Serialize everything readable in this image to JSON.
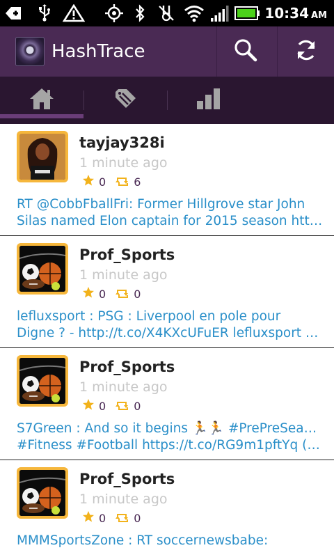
{
  "status_bar": {
    "time": "10:34",
    "ampm": "AM",
    "icons": [
      "usb-debug-icon",
      "usb-icon",
      "warning-icon",
      "gps-icon",
      "bluetooth-icon",
      "vibrate-icon",
      "wifi-icon",
      "signal-icon",
      "battery-icon"
    ]
  },
  "app_bar": {
    "title": "HashTrace",
    "search_icon": "search-icon",
    "refresh_icon": "refresh-icon"
  },
  "tabs": [
    {
      "name": "home",
      "icon": "home-icon",
      "selected": true
    },
    {
      "name": "compose",
      "icon": "pencil-tag-icon",
      "selected": false
    },
    {
      "name": "stats",
      "icon": "bar-chart-icon",
      "selected": false
    }
  ],
  "colors": {
    "app_bar": "#4a2a54",
    "tab_bar": "#2a1630",
    "link_text": "#2a8fc9",
    "star": "#f2b21b",
    "retweet": "#f2b21b",
    "avatar_frame": "#f6b73c"
  },
  "tweets": [
    {
      "username": "tayjay328i",
      "time": "1 minute ago",
      "favorites": "0",
      "retweets": "6",
      "text_line1": "RT @CobbFballFri: Former Hillgrove star John",
      "text_line2": "Silas named Elon captain for 2015 season htt…"
    },
    {
      "username": "Prof_Sports",
      "time": "1 minute ago",
      "favorites": "0",
      "retweets": "0",
      "text_line1": "lefluxsport : PSG : Liverpool en pole pour",
      "text_line2": "Digne ? - http://t.co/X4KXcUFuER lefluxsport …"
    },
    {
      "username": "Prof_Sports",
      "time": "1 minute ago",
      "favorites": "0",
      "retweets": "0",
      "text_line1": "S7Green : And so it begins 🏃🏃 #PrePreSeason",
      "text_line2": "#Fitness #Football https://t.co/RG9m1pftYq (…"
    },
    {
      "username": "Prof_Sports",
      "time": "1 minute ago",
      "favorites": "0",
      "retweets": "0",
      "text_line1": "MMMSportsZone : RT soccernewsbabe:",
      "text_line2": ""
    }
  ]
}
